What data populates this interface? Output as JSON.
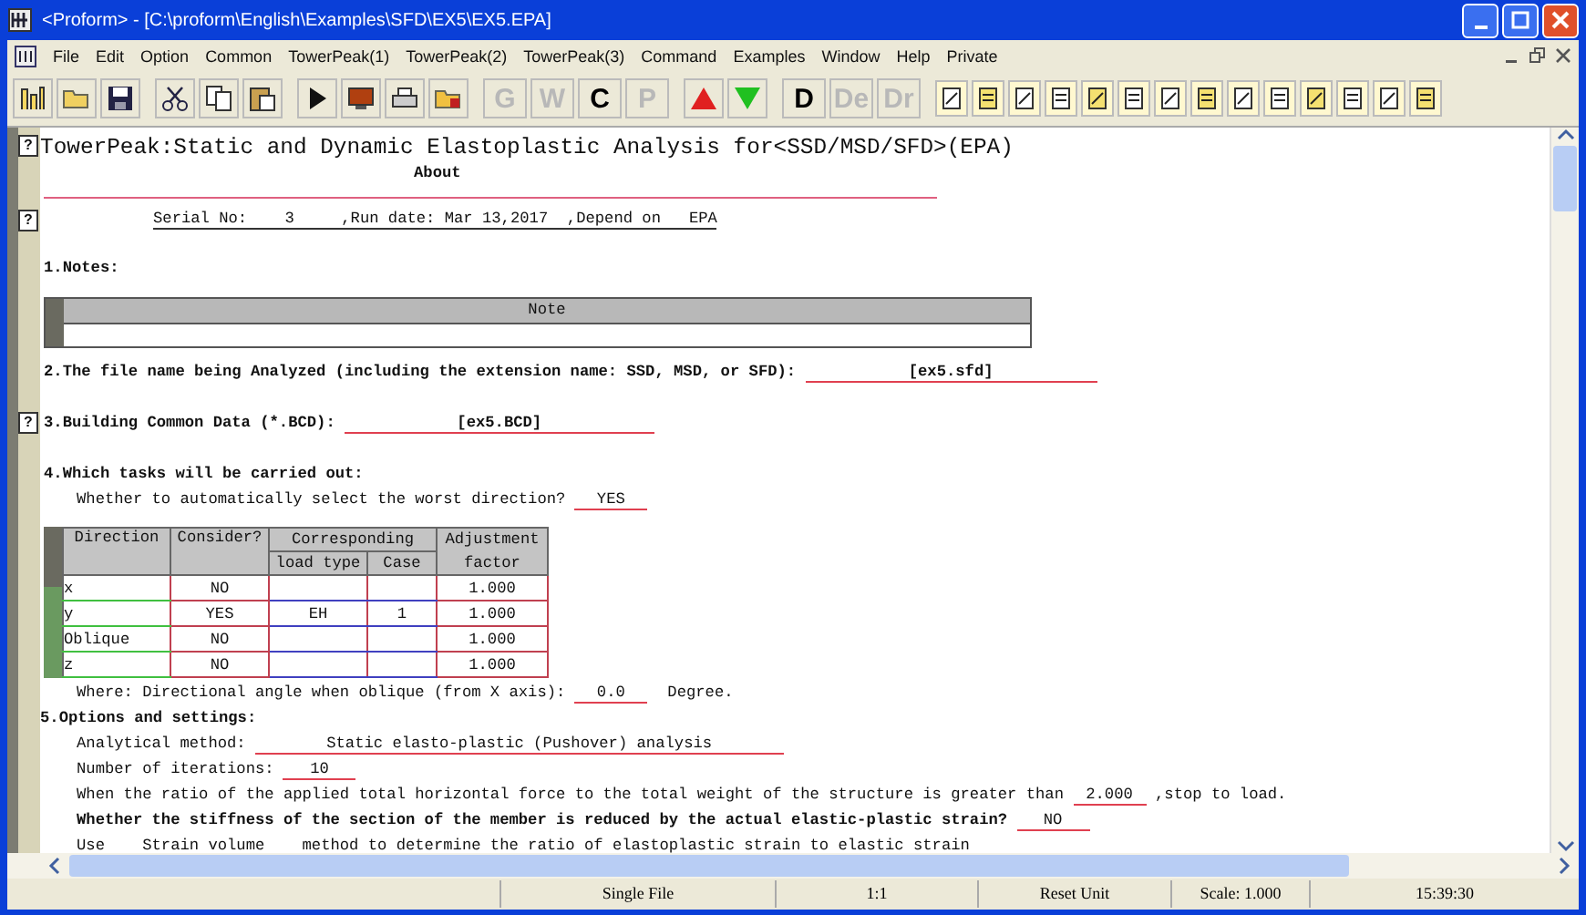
{
  "window": {
    "title": "<Proform> - [C:\\proform\\English\\Examples\\SFD\\EX5\\EX5.EPA]"
  },
  "menu": [
    "File",
    "Edit",
    "Option",
    "Common",
    "TowerPeak(1)",
    "TowerPeak(2)",
    "TowerPeak(3)",
    "Command",
    "Examples",
    "Window",
    "Help",
    "Private"
  ],
  "toolbar": {
    "group_a": [
      {
        "label": "G",
        "disabled": true
      },
      {
        "label": "W",
        "disabled": true
      },
      {
        "label": "C",
        "disabled": false
      },
      {
        "label": "P",
        "disabled": true
      }
    ],
    "group_b": [
      {
        "label": "D",
        "disabled": false
      },
      {
        "label": "De",
        "disabled": true
      },
      {
        "label": "Dr",
        "disabled": true
      }
    ]
  },
  "document": {
    "title": {
      "help": "?",
      "text": "TowerPeak:Static and Dynamic Elastoplastic Analysis for<SSD/MSD/SFD>(EPA)"
    },
    "about": "About",
    "serial": {
      "help": "?",
      "text": "Serial No:    3     ,Run date: Mar 13,2017  ,Depend on   EPA"
    },
    "notes": {
      "heading": "1.Notes:",
      "column": "Note"
    },
    "file": {
      "label": "2.The file name being Analyzed (including the extension name: SSD, MSD, or SFD):",
      "value": "[ex5.sfd]"
    },
    "bcd": {
      "help": "?",
      "label": "3.Building Common Data (*.BCD):",
      "value": "[ex5.BCD]"
    },
    "tasks": {
      "heading": "4.Which tasks will be carried out:",
      "auto": {
        "label": "Whether to automatically select the worst direction?",
        "value": "YES"
      },
      "table": {
        "headers": {
          "direction": "Direction",
          "consider": "Consider?",
          "corresponding": "Corresponding",
          "load_type": "load type",
          "case": "Case",
          "adjustment": "Adjustment",
          "factor": "factor"
        },
        "rows": [
          {
            "direction": "x",
            "consider": "NO",
            "factor": "1.000"
          },
          {
            "direction": "y",
            "consider": "YES",
            "load_type": "EH",
            "case": "1",
            "factor": "1.000"
          },
          {
            "direction": "Oblique",
            "consider": "NO",
            "factor": "1.000"
          },
          {
            "direction": "z",
            "consider": "NO",
            "factor": "1.000"
          }
        ]
      },
      "angle": {
        "label": "Where: Directional angle when oblique (from X axis):",
        "value": "0.0",
        "suffix": "Degree."
      }
    },
    "options": {
      "heading": "5.Options and settings:",
      "method": {
        "label": "Analytical method:",
        "value": "Static elasto-plastic (Pushover) analysis"
      },
      "iterations": {
        "label": "Number of iterations:",
        "value": "10"
      },
      "ratio": {
        "label": "When the ratio of the applied total horizontal force to the total weight of the structure is greater than",
        "value": "2.000",
        "suffix": ",stop to load."
      },
      "stiffness": {
        "label": "Whether the stiffness of the section of the member is reduced by the actual elastic-plastic strain?",
        "value": "NO"
      },
      "strain": "Use    Strain volume    method to determine the ratio of elastoplastic strain to elastic strain"
    }
  },
  "status_bar": [
    "Single File",
    "1:1",
    "Reset Unit",
    "Scale: 1.000",
    "15:39:30"
  ]
}
